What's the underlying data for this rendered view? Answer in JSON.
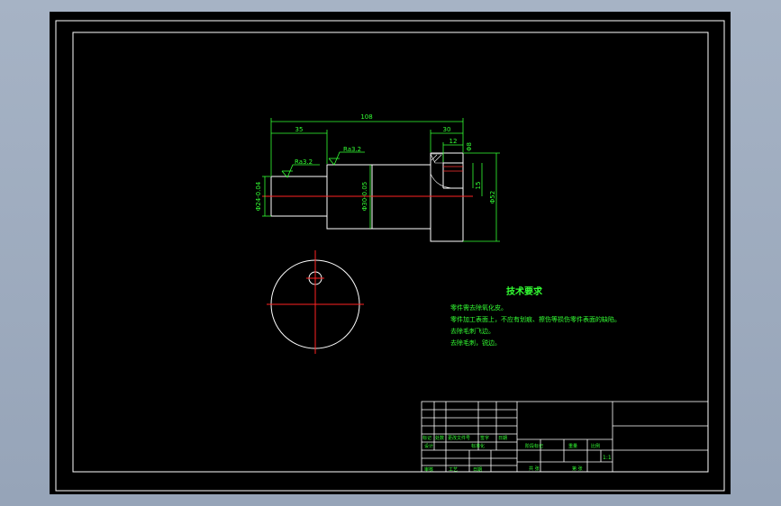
{
  "colors": {
    "background": "#000000",
    "outline": "#ffffff",
    "dimension": "#33ff33",
    "centerline": "#ff2222",
    "window": "#a6b3c5"
  },
  "dimensions": {
    "overall_length": "108",
    "left_length": "35",
    "right_length": "30",
    "right_small": "12",
    "left_dia": "Φ24-0.04",
    "mid_dia": "Φ30-0.05",
    "right_dia": "Φ52",
    "bore": "Φ8",
    "bore_depth": "15"
  },
  "roughness": [
    "Ra3.2",
    "Ra3.2"
  ],
  "notes": {
    "title": "技术要求",
    "lines": [
      "零件需去除氧化皮。",
      "零件加工表面上，不应有划痕、擦伤等损伤零件表面的缺陷。",
      "去除毛刺飞边。",
      "去除毛刺，锐边。"
    ]
  },
  "title_block": {
    "row_labels": [
      "标记",
      "处数",
      "更改文件号",
      "签字",
      "日期"
    ],
    "design_label": "设计",
    "standard_label": "标准化",
    "process_label": "工艺",
    "approve_label": "审核",
    "date_label": "日期",
    "stage_label": "阶段标记",
    "weight_label": "重量",
    "scale_label": "比例",
    "scale_value": "1:1",
    "sheet_total": "共 张",
    "sheet_no": "第 张"
  }
}
